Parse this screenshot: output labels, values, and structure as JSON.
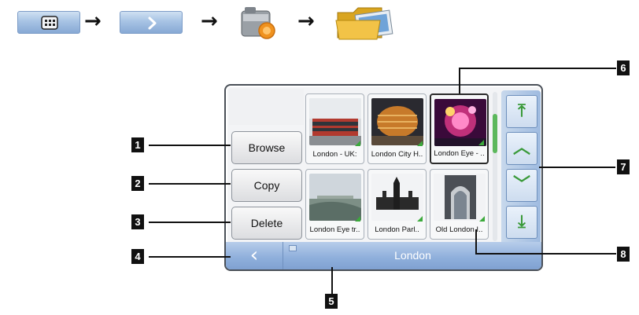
{
  "navigation_path": {
    "steps": [
      {
        "icon": "main-menu-grid-icon"
      },
      {
        "icon": "next-chevron-icon"
      },
      {
        "icon": "camera-icon"
      },
      {
        "icon": "folder-icon"
      }
    ],
    "arrow": "→"
  },
  "side_actions": [
    {
      "label": "Browse"
    },
    {
      "label": "Copy"
    },
    {
      "label": "Delete"
    }
  ],
  "thumbnails": [
    {
      "caption": "London - UK: ",
      "scene": "red-bus"
    },
    {
      "caption": "London City H..",
      "scene": "city-hall"
    },
    {
      "caption": "London Eye - ..",
      "scene": "fireworks"
    },
    {
      "caption": "London Eye tr..",
      "scene": "river-view"
    },
    {
      "caption": "London Parl..",
      "scene": "parliament"
    },
    {
      "caption": "Old London I..",
      "scene": "archway"
    }
  ],
  "scroll_buttons": [
    {
      "icon": "scroll-top-icon",
      "glyph": "⤒"
    },
    {
      "icon": "scroll-up-icon",
      "glyph": "︿"
    },
    {
      "icon": "scroll-down-icon",
      "glyph": "﹀"
    },
    {
      "icon": "scroll-bottom-icon",
      "glyph": "⤓"
    }
  ],
  "bottom_bar": {
    "back_glyph": "‹",
    "folder_name": "London"
  },
  "callouts": [
    "1",
    "2",
    "3",
    "4",
    "5",
    "6",
    "7",
    "8"
  ],
  "colors": {
    "accent_blue": "#90b0dc",
    "check_green": "#3caa3c",
    "badge_black": "#111111"
  }
}
